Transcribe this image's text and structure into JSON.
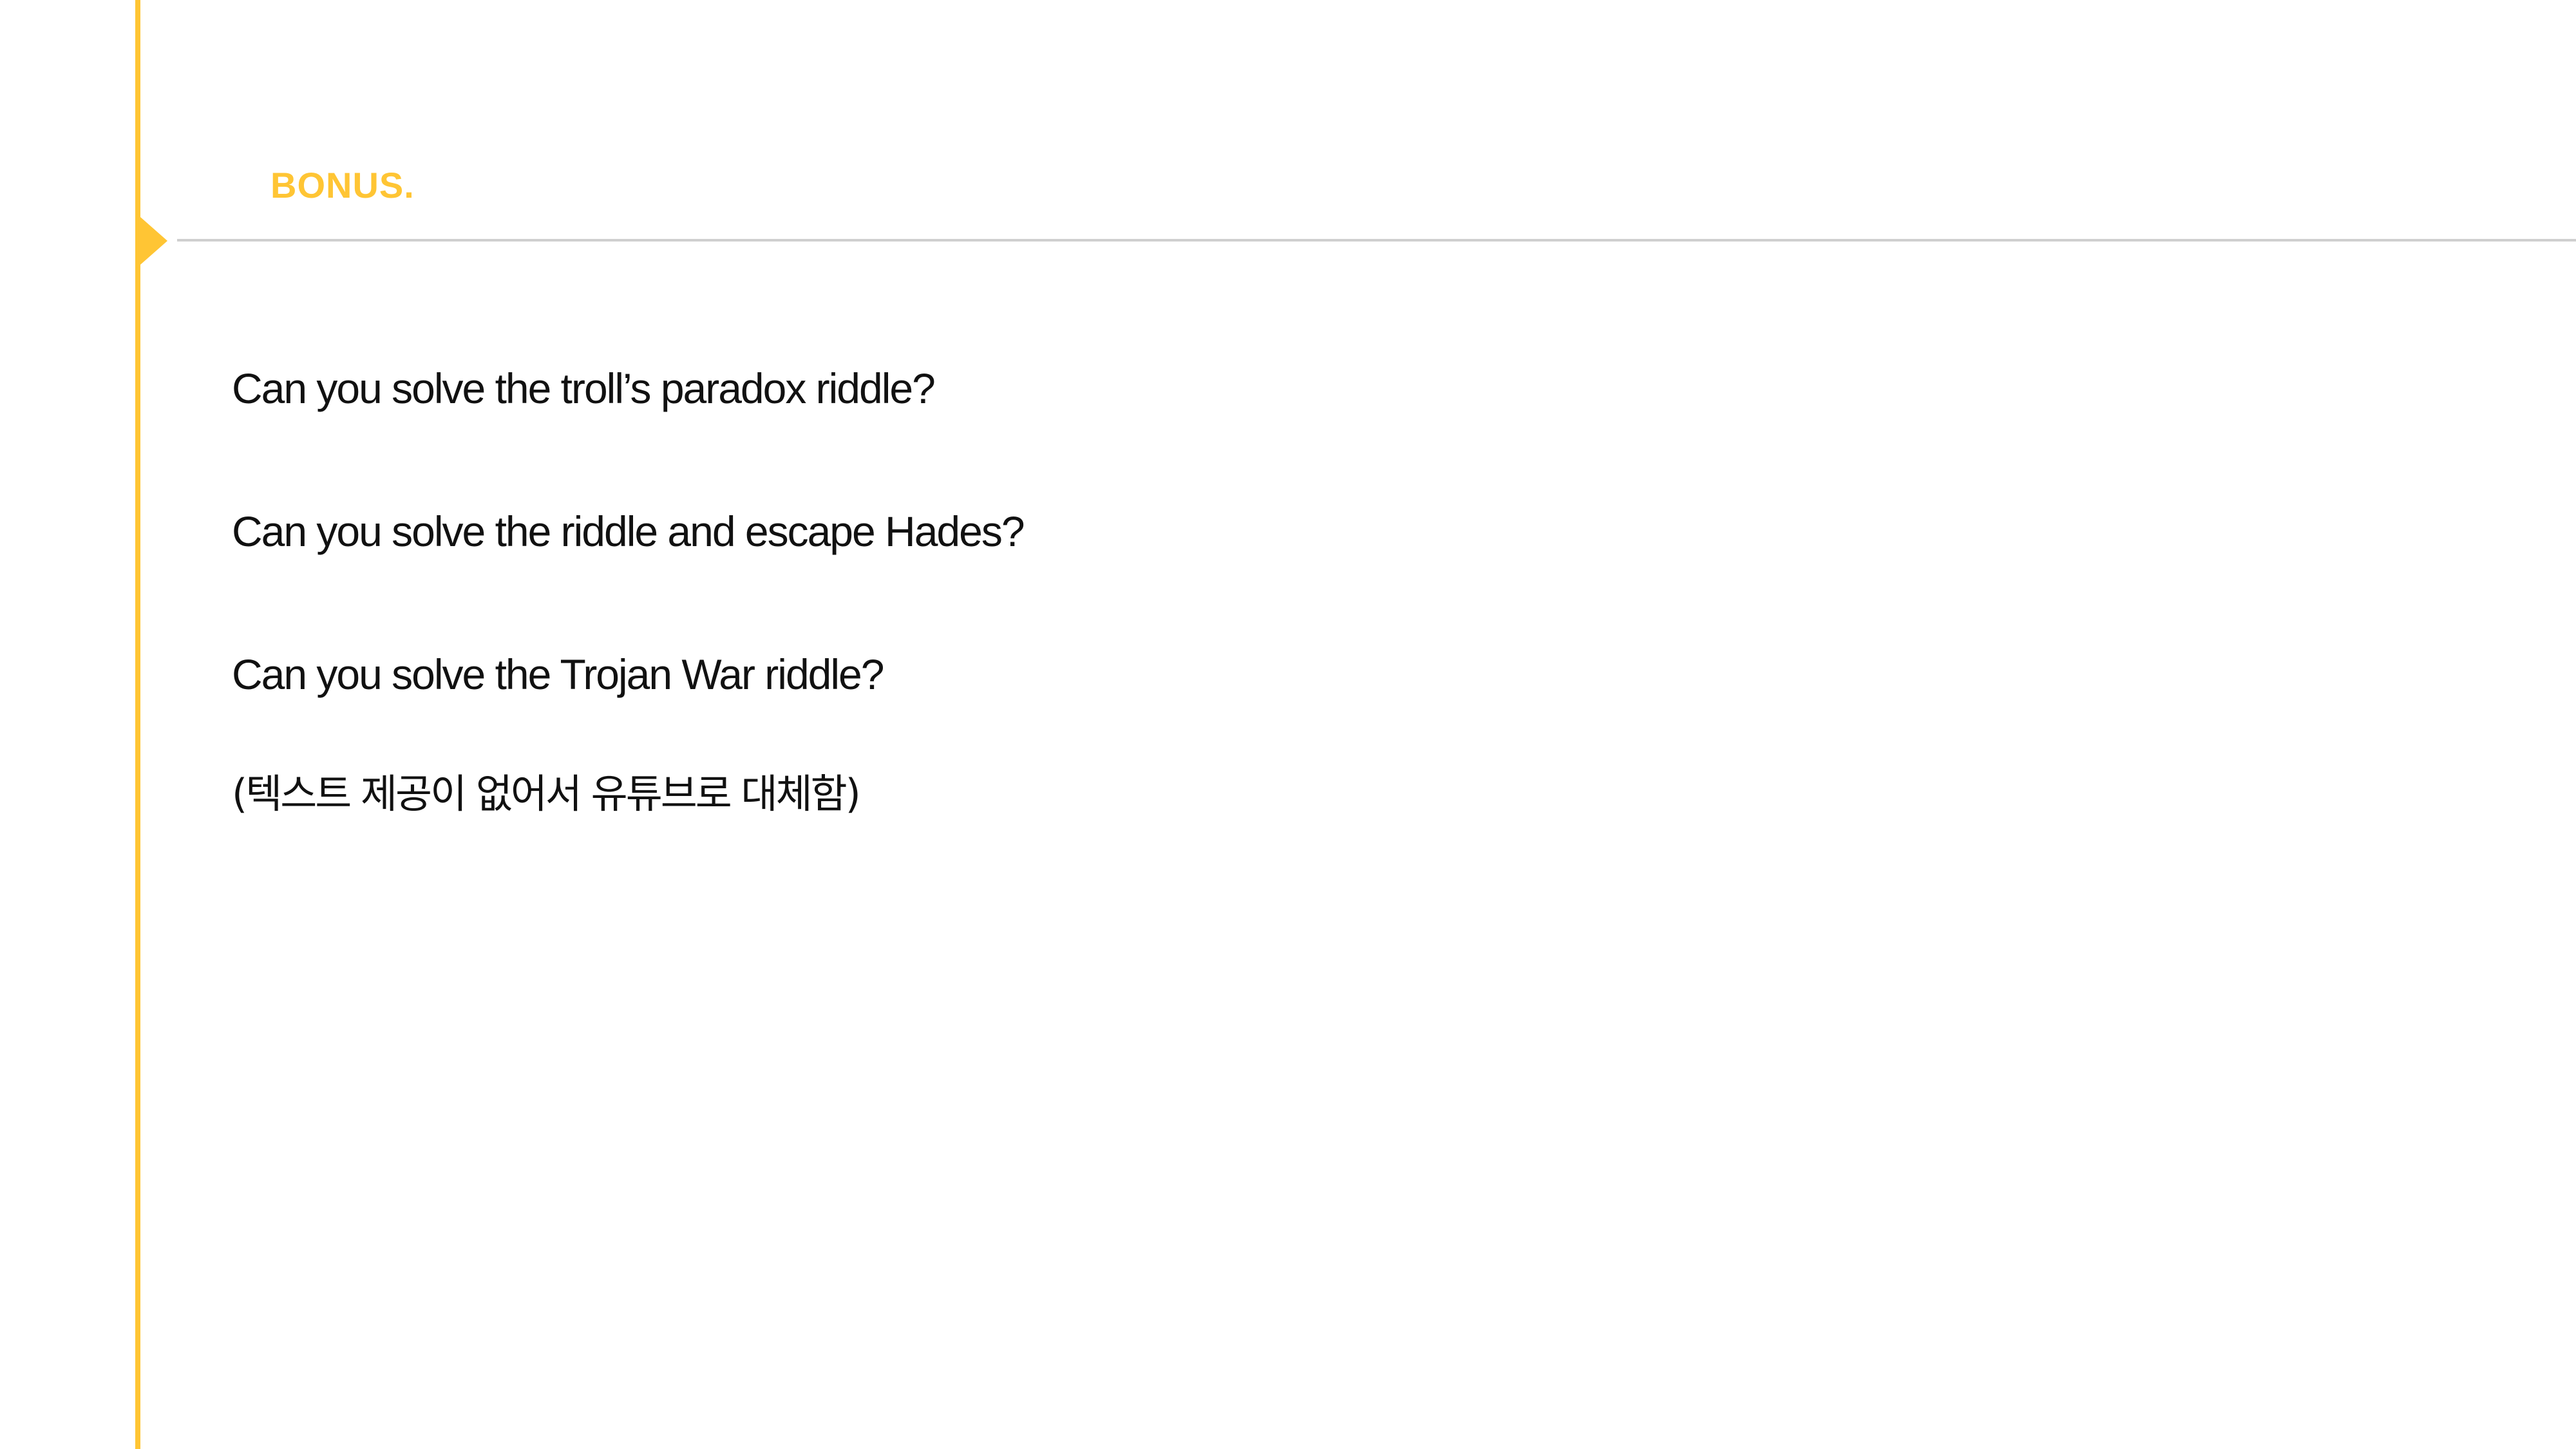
{
  "slide": {
    "section_label": "BONUS.",
    "items": [
      "Can you solve the troll’s paradox riddle?",
      "Can you solve the riddle and escape Hades?",
      "Can you solve the Trojan War riddle?"
    ],
    "note": "(텍스트 제공이 없어서 유튜브로 대체함)"
  },
  "colors": {
    "accent": "#FFC534",
    "divider": "#CFCFCF",
    "text": "#111111",
    "background": "#FFFFFF"
  }
}
